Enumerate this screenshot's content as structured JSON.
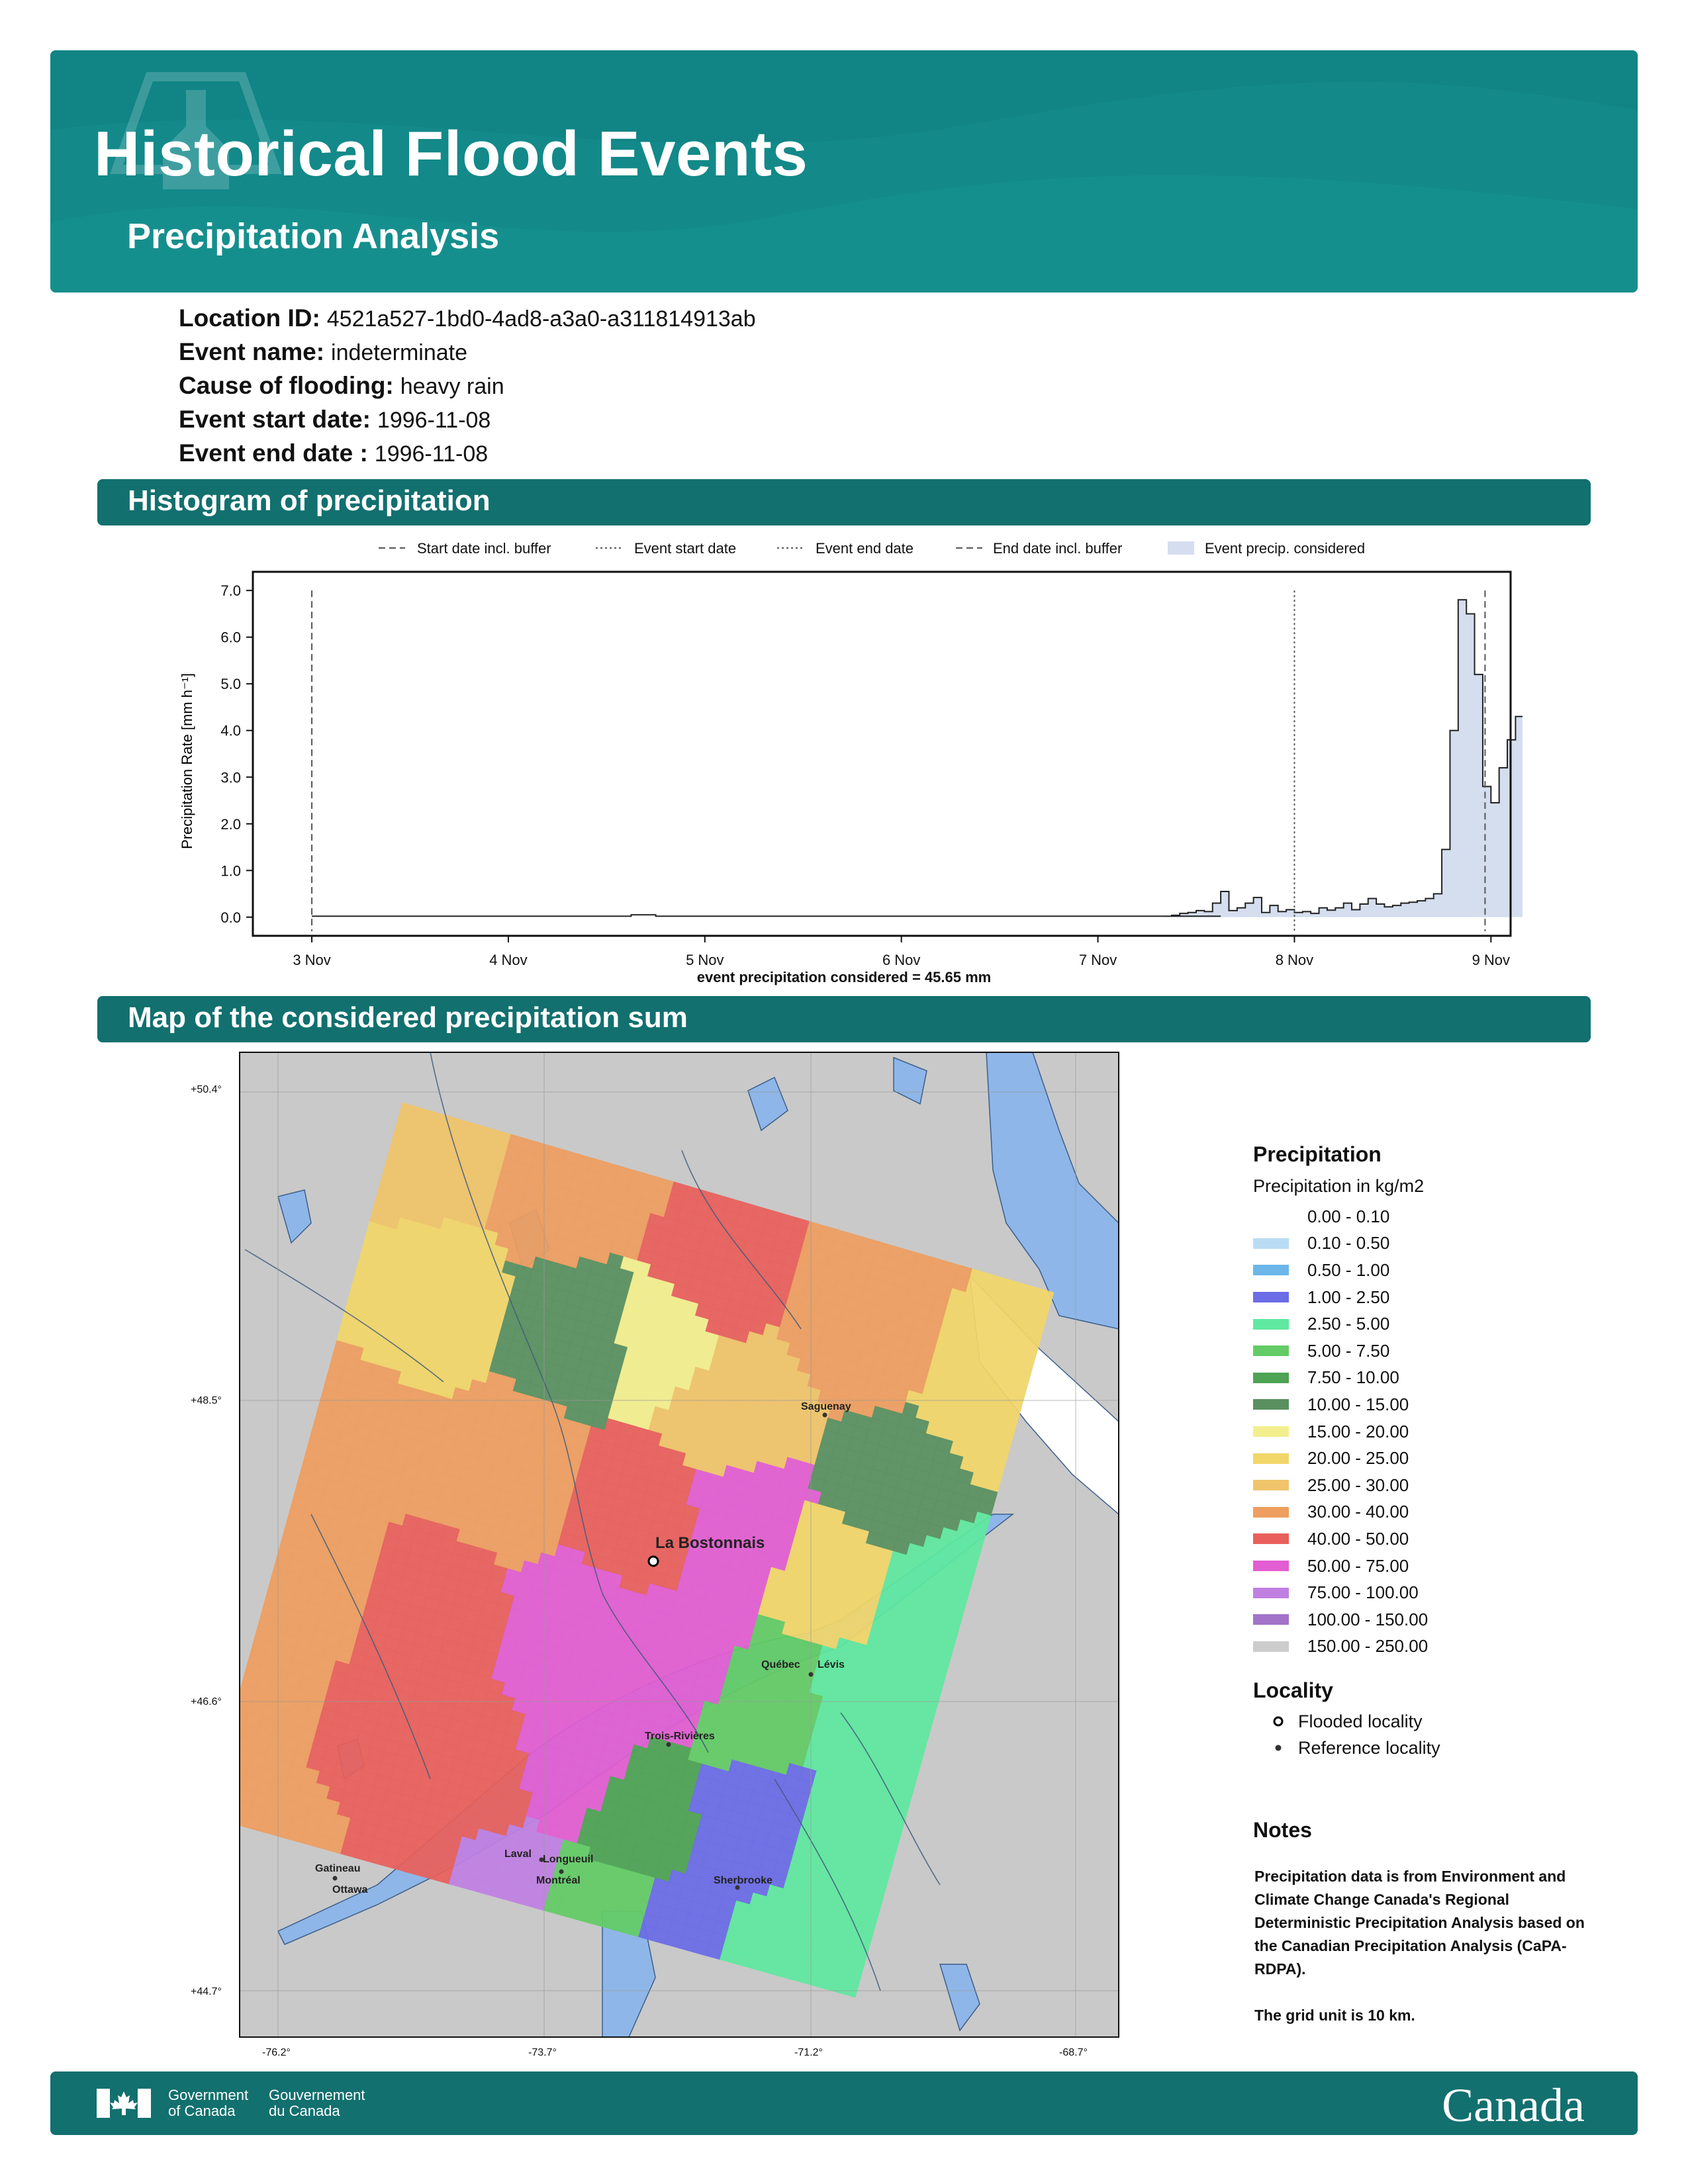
{
  "header": {
    "title": "Historical Flood Events",
    "subtitle": "Precipitation Analysis"
  },
  "info": [
    {
      "label": "Location ID:",
      "value": "4521a527-1bd0-4ad8-a3a0-a311814913ab"
    },
    {
      "label": "Event name:",
      "value": "indeterminate"
    },
    {
      "label": "Cause of flooding:",
      "value": "heavy rain"
    },
    {
      "label": "Event start date:",
      "value": "1996-11-08"
    },
    {
      "label": "Event end date :",
      "value": "1996-11-08"
    }
  ],
  "sections": {
    "histogram": "Histogram of precipitation",
    "map": "Map of the considered precipitation sum"
  },
  "chart_data": {
    "type": "area",
    "ylabel": "Precipitation Rate [mm h⁻¹]",
    "xlabel": "event precipitation considered = 45.65 mm",
    "x_ticks": [
      "3 Nov",
      "4 Nov",
      "5 Nov",
      "6 Nov",
      "7 Nov",
      "8 Nov",
      "9 Nov"
    ],
    "y_ticks": [
      "0.0",
      "1.0",
      "2.0",
      "3.0",
      "4.0",
      "5.0",
      "6.0",
      "7.0"
    ],
    "ylim": [
      -0.4,
      7.4
    ],
    "xlim_days": [
      2.7,
      9.1
    ],
    "legend": [
      {
        "label": "Start date incl. buffer",
        "style": "dashed"
      },
      {
        "label": "Event start date",
        "style": "dotted"
      },
      {
        "label": "Event end date",
        "style": "dotted"
      },
      {
        "label": "End date incl. buffer",
        "style": "dashed"
      },
      {
        "label": "Event precip. considered",
        "style": "fill"
      }
    ],
    "vlines": [
      {
        "day": 3.0,
        "style": "dashed"
      },
      {
        "day": 8.0,
        "style": "dotted"
      },
      {
        "day": 8.97,
        "style": "dashed"
      }
    ],
    "hourly_from_day_8": [
      0.1,
      0.12,
      0.08,
      0.2,
      0.15,
      0.2,
      0.3,
      0.16,
      0.28,
      0.4,
      0.28,
      0.22,
      0.25,
      0.3,
      0.32,
      0.35,
      0.4,
      0.5,
      1.45,
      4.0,
      6.8,
      6.5,
      5.2,
      2.8,
      2.45,
      3.2,
      3.8,
      4.3,
      4.6,
      4.1,
      3.7
    ],
    "hourly_late_day_7": [
      0.02,
      0.04,
      0.08,
      0.1,
      0.14,
      0.12,
      0.3,
      0.55,
      0.14,
      0.2,
      0.3,
      0.42,
      0.1,
      0.25,
      0.12,
      0.16
    ],
    "fill_color": "#d4deef",
    "line_color": "#222222"
  },
  "map": {
    "lat_ticks": [
      "+50.4°",
      "+48.5°",
      "+46.6°",
      "+44.7°"
    ],
    "lon_ticks": [
      "-76.2°",
      "-73.7°",
      "-71.2°",
      "-68.7°"
    ],
    "places": [
      {
        "name": "La Bostonnais",
        "type": "flooded"
      },
      {
        "name": "Saguenay",
        "type": "reference"
      },
      {
        "name": "Québec",
        "type": "reference"
      },
      {
        "name": "Lévis",
        "type": "reference"
      },
      {
        "name": "Trois-Rivières",
        "type": "reference"
      },
      {
        "name": "Laval",
        "type": "reference"
      },
      {
        "name": "Longueuil",
        "type": "reference"
      },
      {
        "name": "Montréal",
        "type": "reference"
      },
      {
        "name": "Gatineau",
        "type": "reference"
      },
      {
        "name": "Ottawa",
        "type": "reference"
      },
      {
        "name": "Sherbrooke",
        "type": "reference"
      }
    ]
  },
  "legend": {
    "title": "Precipitation",
    "subtitle": "Precipitation in kg/m2",
    "bins": [
      {
        "label": "0.00 - 0.10",
        "color": "#ffffff"
      },
      {
        "label": "0.10 - 0.50",
        "color": "#b9dcf4"
      },
      {
        "label": "0.50 - 1.00",
        "color": "#6cb6ea"
      },
      {
        "label": "1.00 - 2.50",
        "color": "#6b6ce6"
      },
      {
        "label": "2.50 - 5.00",
        "color": "#5fe9a0"
      },
      {
        "label": "5.00 - 7.50",
        "color": "#63cc66"
      },
      {
        "label": "7.50 - 10.00",
        "color": "#4ea354"
      },
      {
        "label": "10.00 - 15.00",
        "color": "#5a9060"
      },
      {
        "label": "15.00 - 20.00",
        "color": "#f3ef8e"
      },
      {
        "label": "20.00 - 25.00",
        "color": "#f1d66a"
      },
      {
        "label": "25.00 - 30.00",
        "color": "#f0c46a"
      },
      {
        "label": "30.00 - 40.00",
        "color": "#ee9e60"
      },
      {
        "label": "40.00 - 50.00",
        "color": "#e9605c"
      },
      {
        "label": "50.00 - 75.00",
        "color": "#e25ed2"
      },
      {
        "label": "75.00 - 100.00",
        "color": "#c080e2"
      },
      {
        "label": "100.00 - 150.00",
        "color": "#a273c9"
      },
      {
        "label": "150.00 - 250.00",
        "color": "#cccccc"
      }
    ],
    "locality_title": "Locality",
    "flooded_label": "Flooded locality",
    "reference_label": "Reference locality"
  },
  "notes": {
    "title": "Notes",
    "text1": "Precipitation data is from Environment and Climate Change Canada's Regional Deterministic Precipitation Analysis based on the Canadian Precipitation Analysis (CaPA-RDPA).",
    "text2": "The grid unit is 10 km."
  },
  "footer": {
    "gov_en_1": "Government",
    "gov_en_2": "of Canada",
    "gov_fr_1": "Gouvernement",
    "gov_fr_2": "du Canada",
    "wordmark": "Canada"
  }
}
